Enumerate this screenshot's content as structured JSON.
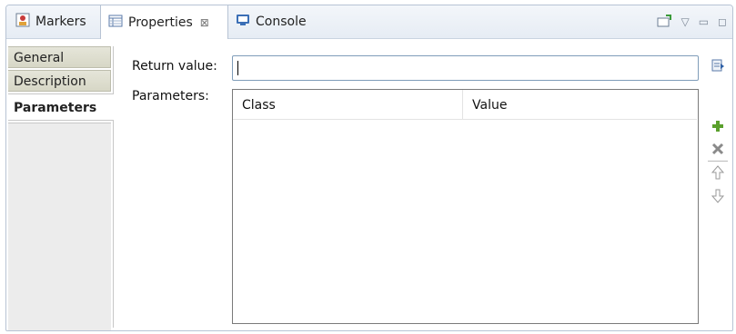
{
  "tabs": [
    {
      "label": "Markers",
      "icon": "markers-icon"
    },
    {
      "label": "Properties",
      "icon": "properties-icon",
      "active": true,
      "close": "⊠"
    },
    {
      "label": "Console",
      "icon": "console-icon"
    }
  ],
  "sections": [
    {
      "label": "General"
    },
    {
      "label": "Description"
    },
    {
      "label": "Parameters",
      "active": true
    }
  ],
  "form": {
    "return_label": "Return value:",
    "return_value": "",
    "parameters_label": "Parameters:"
  },
  "table": {
    "columns": [
      "Class",
      "Value"
    ],
    "rows": []
  },
  "toolbar": {
    "export": "export-icon",
    "add": "add-icon",
    "remove": "remove-icon",
    "up": "move-up-icon",
    "down": "move-down-icon"
  },
  "colors": {
    "accent": "#5aa02c",
    "tab_bg": "#e6ecf4",
    "section_bg": "#d7d7c6"
  }
}
